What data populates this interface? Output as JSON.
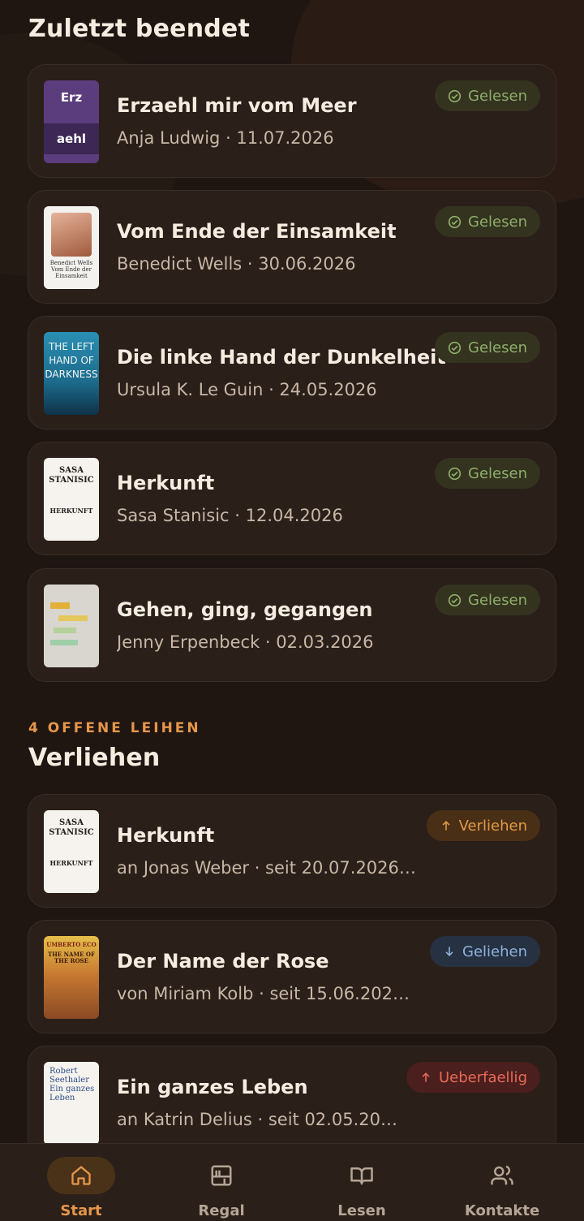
{
  "finished": {
    "title": "Zuletzt beendet",
    "items": [
      {
        "title": "Erzaehl mir vom Meer",
        "sub": "Anja Ludwig · 11.07.2026",
        "badge": "Gelesen",
        "cover_top": "Erz",
        "cover_bottom": "aehl"
      },
      {
        "title": "Vom Ende der Einsamkeit",
        "sub": "Benedict Wells · 30.06.2026",
        "badge": "Gelesen",
        "cover_text": "Benedict Wells Vom Ende der Einsamkeit"
      },
      {
        "title": "Die linke Hand der Dunkelheit",
        "sub": "Ursula K. Le Guin · 24.05.2026",
        "badge": "Gelesen",
        "cover_text": "THE LEFT HAND OF DARKNESS"
      },
      {
        "title": "Herkunft",
        "sub": "Sasa Stanisic · 12.04.2026",
        "badge": "Gelesen",
        "cover_top": "SASA STANISIC",
        "cover_bottom": "HERKUNFT"
      },
      {
        "title": "Gehen, ging, gegangen",
        "sub": "Jenny Erpenbeck · 02.03.2026",
        "badge": "Gelesen"
      }
    ]
  },
  "lent": {
    "kicker": "4 OFFENE LEIHEN",
    "title": "Verliehen",
    "items": [
      {
        "title": "Herkunft",
        "sub": "an Jonas Weber · seit 20.07.2026…",
        "badge": "Verliehen",
        "cover_top": "SASA STANISIC",
        "cover_bottom": "HERKUNFT"
      },
      {
        "title": "Der Name der Rose",
        "sub": "von Miriam Kolb · seit 15.06.2026 ·…",
        "badge": "Geliehen",
        "cover_top": "UMBERTO ECO",
        "cover_bottom": "THE NAME OF THE ROSE"
      },
      {
        "title": "Ein ganzes Leben",
        "sub": "an Katrin Delius · seit 02.05.20…",
        "badge": "Ueberfaellig",
        "cover_text": "Robert Seethaler Ein ganzes Leben"
      }
    ]
  },
  "nav": {
    "items": [
      {
        "label": "Start",
        "icon": "home-icon",
        "active": true
      },
      {
        "label": "Regal",
        "icon": "shelf-icon"
      },
      {
        "label": "Lesen",
        "icon": "book-open-icon"
      },
      {
        "label": "Kontakte",
        "icon": "contacts-icon"
      }
    ]
  },
  "colors": {
    "background": "#1f1612",
    "card": "#2a1f19",
    "accent": "#e6964a",
    "read": "#8fae6a",
    "borrowed": "#8db2dc",
    "overdue": "#e86a58"
  }
}
